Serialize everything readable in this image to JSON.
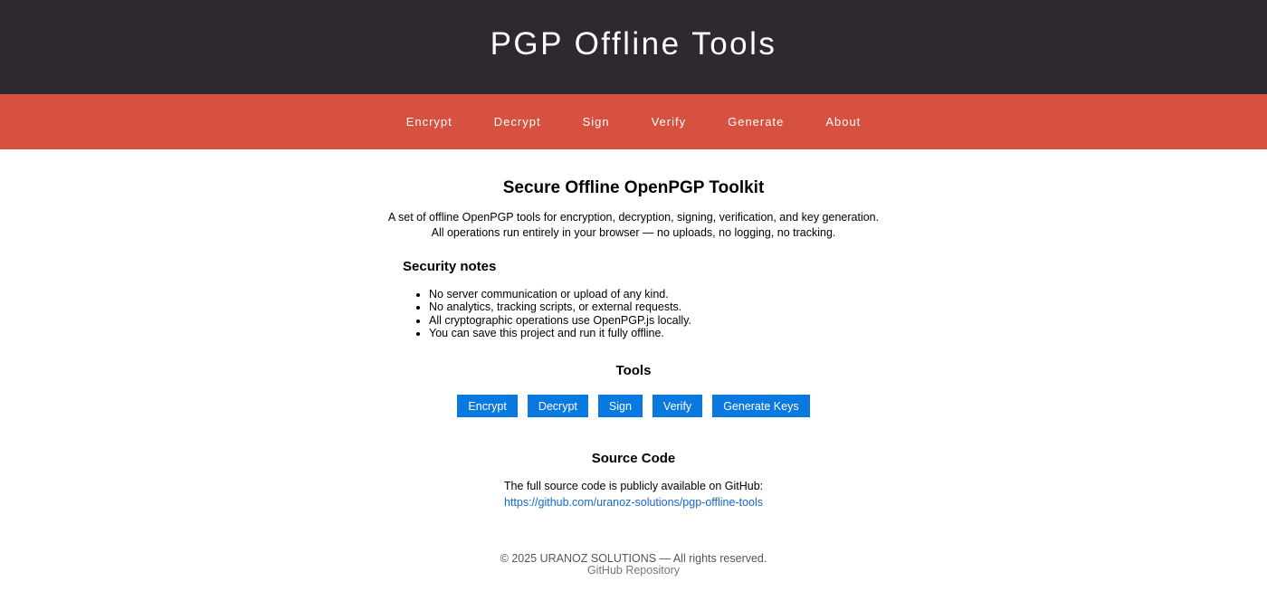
{
  "header": {
    "title": "PGP Offline Tools"
  },
  "nav": {
    "items": [
      {
        "label": "Encrypt"
      },
      {
        "label": "Decrypt"
      },
      {
        "label": "Sign"
      },
      {
        "label": "Verify"
      },
      {
        "label": "Generate"
      },
      {
        "label": "About"
      }
    ]
  },
  "main": {
    "title": "Secure Offline OpenPGP Toolkit",
    "intro_line1": "A set of offline OpenPGP tools for encryption, decryption, signing, verification, and key generation.",
    "intro_line2": "All operations run entirely in your browser — no uploads, no logging, no tracking."
  },
  "security": {
    "title": "Security notes",
    "items": [
      "No server communication or upload of any kind.",
      "No analytics, tracking scripts, or external requests.",
      "All cryptographic operations use OpenPGP.js locally.",
      "You can save this project and run it fully offline."
    ]
  },
  "tools": {
    "title": "Tools",
    "buttons": [
      {
        "label": "Encrypt"
      },
      {
        "label": "Decrypt"
      },
      {
        "label": "Sign"
      },
      {
        "label": "Verify"
      },
      {
        "label": "Generate Keys"
      }
    ]
  },
  "source": {
    "title": "Source Code",
    "text": "The full source code is publicly available on GitHub:",
    "link": "https://github.com/uranoz-solutions/pgp-offline-tools"
  },
  "footer": {
    "copyright": "© 2025 URANOZ SOLUTIONS — All rights reserved.",
    "repo_link": "GitHub Repository"
  },
  "colors": {
    "header_bg": "#2f282e",
    "nav_bg": "#d65140",
    "button_bg": "#0a79df",
    "link": "#1668c9"
  }
}
